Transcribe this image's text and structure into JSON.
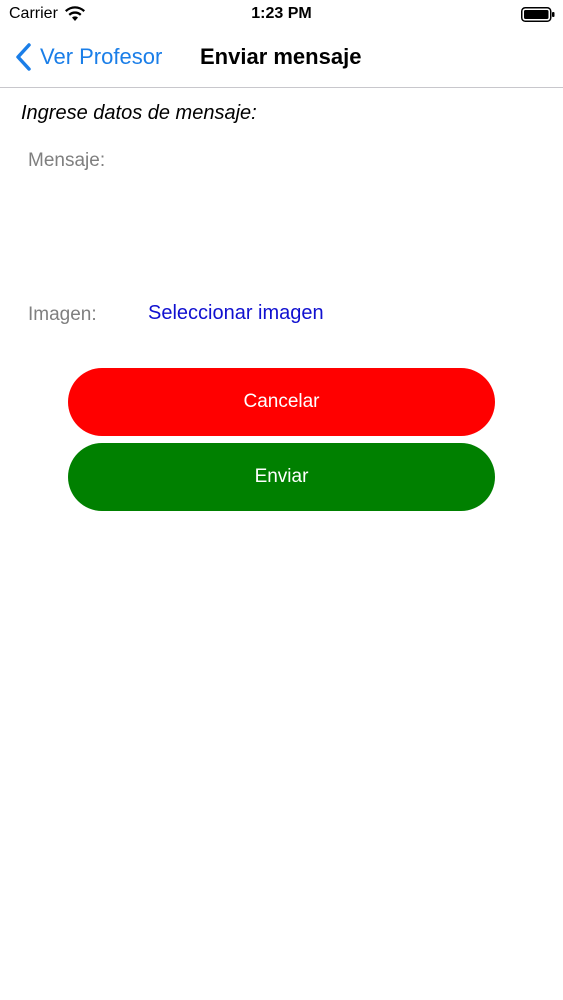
{
  "status_bar": {
    "carrier": "Carrier",
    "time": "1:23 PM",
    "wifi_icon": "wifi-icon",
    "battery_icon": "battery-icon"
  },
  "nav": {
    "back_label": "Ver Profesor",
    "back_icon": "chevron-left-icon",
    "title": "Enviar mensaje",
    "tint_color": "#1a7ee8"
  },
  "form": {
    "heading": "Ingrese datos de mensaje:",
    "message_label": "Mensaje:",
    "message_value": "",
    "image_label": "Imagen:",
    "select_image_label": "Seleccionar imagen"
  },
  "buttons": {
    "cancel_label": "Cancelar",
    "cancel_color": "#ff0000",
    "send_label": "Enviar",
    "send_color": "#008000"
  }
}
